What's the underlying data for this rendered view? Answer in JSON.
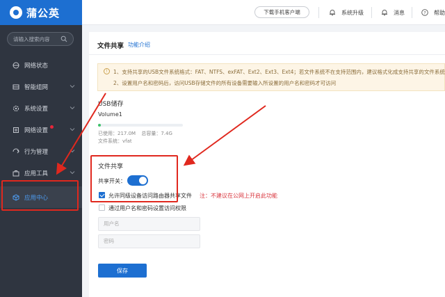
{
  "app": {
    "name": "蒲公英"
  },
  "sidebar": {
    "search_placeholder": "请输入搜索内容",
    "items": [
      {
        "label": "网络状态",
        "icon": "network-status-icon",
        "has_chevron": false
      },
      {
        "label": "智能组网",
        "icon": "smart-network-icon",
        "has_chevron": true
      },
      {
        "label": "系统设置",
        "icon": "gear-icon",
        "has_chevron": true
      },
      {
        "label": "网络设置",
        "icon": "network-settings-icon",
        "has_chevron": true,
        "badge_dot": true
      },
      {
        "label": "行为管理",
        "icon": "behavior-icon",
        "has_chevron": true
      },
      {
        "label": "应用工具",
        "icon": "toolbox-icon",
        "has_chevron": true
      },
      {
        "label": "应用中心",
        "icon": "cube-icon",
        "has_chevron": false,
        "active": true
      }
    ]
  },
  "topbar": {
    "download_label": "下载手机客户端",
    "upgrade_label": "系统升级",
    "messages_label": "消息",
    "help_label": "帮助"
  },
  "page": {
    "title": "文件共享",
    "help_link": "功能介绍",
    "notice": {
      "line1": "1、支持共享的USB文件系统格式：FAT、NTFS、exFAT、Ext2、Ext3、Ext4；若文件系统不在支持范围内，建议格式化成支持共享的文件系统",
      "line2": "2、设置用户名和密码后，访问USB存储文件的所有设备需要输入所设置的用户名和密码才可访问"
    },
    "usb": {
      "title": "USB储存",
      "volume_name": "Volume1",
      "used_label": "已使用：",
      "used_value": "217.0M",
      "total_label": "总容量：",
      "total_value": "7.4G",
      "fs_label": "文件系统：",
      "fs_value": "vfat",
      "usage_fraction": 0.03
    },
    "sharing": {
      "section_title": "文件共享",
      "toggle_label": "共享开关：",
      "toggle_on": true,
      "allow_lan_label": "允许同级设备访问路由器共享文件",
      "allow_lan_checked": true,
      "warning": "注：不建议在公网上开启此功能",
      "auth_label": "通过用户名和密码设置访问权限",
      "auth_checked": false,
      "username_placeholder": "用户名",
      "password_placeholder": "密码",
      "save_label": "保存"
    }
  },
  "colors": {
    "brand": "#1d6fd1",
    "sidebar_bg": "#2f3540",
    "annotation_red": "#e0281e",
    "warning_red": "#d9363e"
  }
}
